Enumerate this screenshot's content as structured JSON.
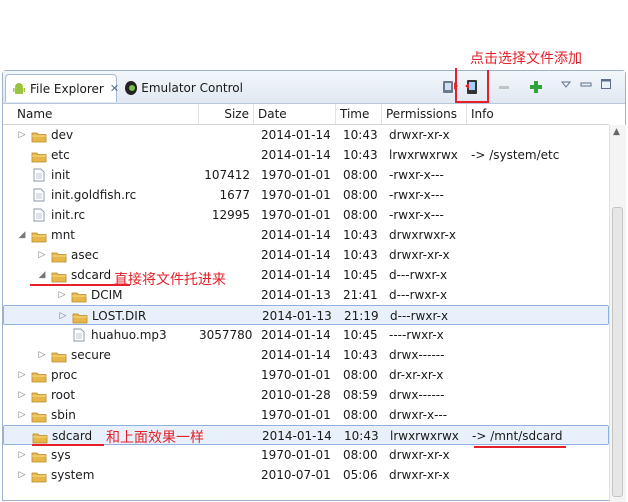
{
  "tabs": [
    {
      "label": "File Explorer",
      "icon": "android-icon",
      "active": true
    },
    {
      "label": "Emulator Control",
      "icon": "emulator-icon",
      "active": false
    }
  ],
  "toolbar": {
    "pull_icon": "device-pull-icon",
    "push_icon": "device-push-icon",
    "delete_icon": "minus-icon",
    "add_icon": "plus-icon",
    "menu_icon": "view-menu-icon",
    "minimize_icon": "minimize-icon",
    "maximize_icon": "maximize-icon"
  },
  "columns": [
    "Name",
    "Size",
    "Date",
    "Time",
    "Permissions",
    "Info"
  ],
  "rows": [
    {
      "name": "dev",
      "type": "folder",
      "depth": 0,
      "arrow": "collapsed",
      "size": "",
      "date": "2014-01-14",
      "time": "10:43",
      "perm": "drwxr-xr-x",
      "info": ""
    },
    {
      "name": "etc",
      "type": "folder",
      "depth": 0,
      "arrow": "none",
      "size": "",
      "date": "2014-01-14",
      "time": "10:43",
      "perm": "lrwxrwxrwx",
      "info": "-> /system/etc"
    },
    {
      "name": "init",
      "type": "file",
      "depth": 0,
      "arrow": "none",
      "size": "107412",
      "date": "1970-01-01",
      "time": "08:00",
      "perm": "-rwxr-x---",
      "info": ""
    },
    {
      "name": "init.goldfish.rc",
      "type": "file",
      "depth": 0,
      "arrow": "none",
      "size": "1677",
      "date": "1970-01-01",
      "time": "08:00",
      "perm": "-rwxr-x---",
      "info": ""
    },
    {
      "name": "init.rc",
      "type": "file",
      "depth": 0,
      "arrow": "none",
      "size": "12995",
      "date": "1970-01-01",
      "time": "08:00",
      "perm": "-rwxr-x---",
      "info": ""
    },
    {
      "name": "mnt",
      "type": "folder",
      "depth": 0,
      "arrow": "expanded",
      "size": "",
      "date": "2014-01-14",
      "time": "10:43",
      "perm": "drwxrwxr-x",
      "info": ""
    },
    {
      "name": "asec",
      "type": "folder",
      "depth": 1,
      "arrow": "collapsed",
      "size": "",
      "date": "2014-01-14",
      "time": "10:43",
      "perm": "drwxr-xr-x",
      "info": ""
    },
    {
      "name": "sdcard",
      "type": "folder",
      "depth": 1,
      "arrow": "expanded",
      "size": "",
      "date": "2014-01-14",
      "time": "10:45",
      "perm": "d---rwxr-x",
      "info": ""
    },
    {
      "name": "DCIM",
      "type": "folder",
      "depth": 2,
      "arrow": "collapsed",
      "size": "",
      "date": "2014-01-13",
      "time": "21:41",
      "perm": "d---rwxr-x",
      "info": ""
    },
    {
      "name": "LOST.DIR",
      "type": "folder",
      "depth": 2,
      "arrow": "collapsed",
      "size": "",
      "date": "2014-01-13",
      "time": "21:19",
      "perm": "d---rwxr-x",
      "info": "",
      "selected": true
    },
    {
      "name": "huahuo.mp3",
      "type": "file",
      "depth": 2,
      "arrow": "none",
      "size": "3057780",
      "date": "2014-01-14",
      "time": "10:45",
      "perm": "----rwxr-x",
      "info": ""
    },
    {
      "name": "secure",
      "type": "folder",
      "depth": 1,
      "arrow": "collapsed",
      "size": "",
      "date": "2014-01-14",
      "time": "10:43",
      "perm": "drwx------",
      "info": ""
    },
    {
      "name": "proc",
      "type": "folder",
      "depth": 0,
      "arrow": "collapsed",
      "size": "",
      "date": "1970-01-01",
      "time": "08:00",
      "perm": "dr-xr-xr-x",
      "info": ""
    },
    {
      "name": "root",
      "type": "folder",
      "depth": 0,
      "arrow": "collapsed",
      "size": "",
      "date": "2010-01-28",
      "time": "08:59",
      "perm": "drwx------",
      "info": ""
    },
    {
      "name": "sbin",
      "type": "folder",
      "depth": 0,
      "arrow": "collapsed",
      "size": "",
      "date": "1970-01-01",
      "time": "08:00",
      "perm": "drwxr-x---",
      "info": ""
    },
    {
      "name": "sdcard",
      "type": "folder",
      "depth": 0,
      "arrow": "none",
      "size": "",
      "date": "2014-01-14",
      "time": "10:43",
      "perm": "lrwxrwxrwx",
      "info": "-> /mnt/sdcard",
      "selected": true
    },
    {
      "name": "sys",
      "type": "folder",
      "depth": 0,
      "arrow": "collapsed",
      "size": "",
      "date": "1970-01-01",
      "time": "08:00",
      "perm": "drwxr-xr-x",
      "info": ""
    },
    {
      "name": "system",
      "type": "folder",
      "depth": 0,
      "arrow": "collapsed",
      "size": "",
      "date": "2010-07-01",
      "time": "05:06",
      "perm": "drwxr-xr-x",
      "info": ""
    }
  ],
  "annotations": {
    "push_note": "点击选择文件添加",
    "drag_note": "直接将文件托进来",
    "same_note": "和上面效果一样"
  },
  "colors": {
    "annotation": "#e5202a",
    "folder": "#e8b74a",
    "selection": "#e8f1fb"
  }
}
